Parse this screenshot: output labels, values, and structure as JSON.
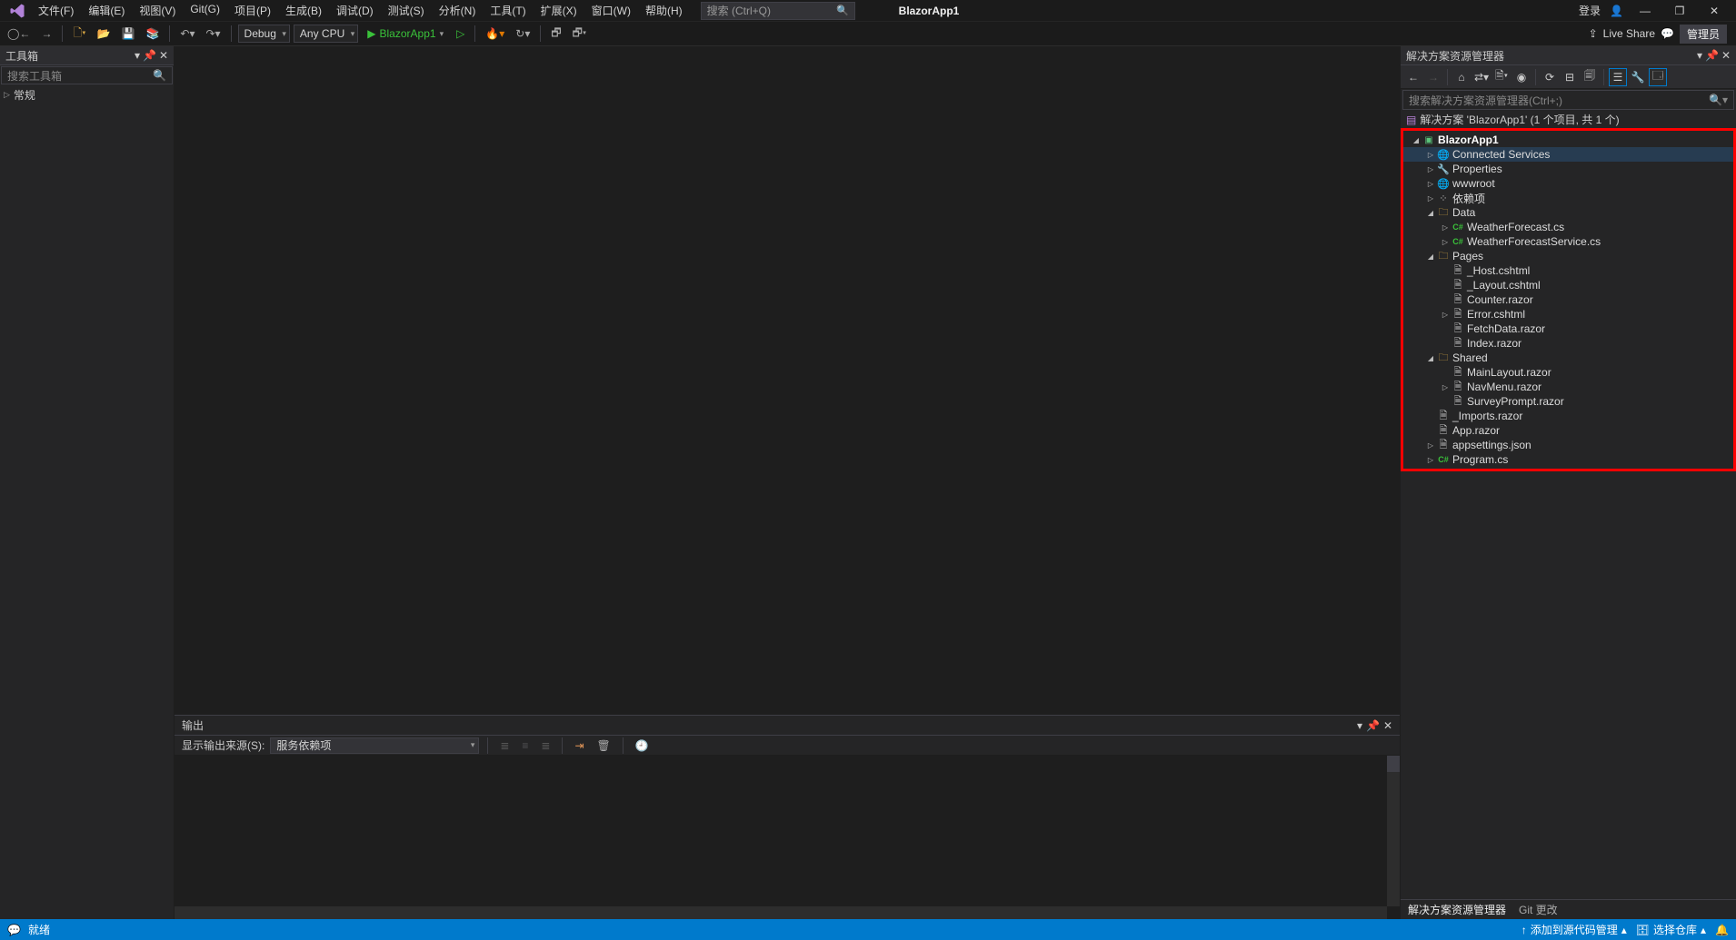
{
  "menubar": {
    "items": [
      "文件(F)",
      "编辑(E)",
      "视图(V)",
      "Git(G)",
      "项目(P)",
      "生成(B)",
      "调试(D)",
      "测试(S)",
      "分析(N)",
      "工具(T)",
      "扩展(X)",
      "窗口(W)",
      "帮助(H)"
    ],
    "search_placeholder": "搜索 (Ctrl+Q)",
    "app_title": "BlazorApp1",
    "login": "登录",
    "window_min": "—",
    "window_restore": "❐",
    "window_close": "✕"
  },
  "toolbar": {
    "config": "Debug",
    "platform": "Any CPU",
    "run_target": "BlazorApp1",
    "live_share": "Live Share",
    "admin": "管理员"
  },
  "toolbox": {
    "title": "工具箱",
    "search_placeholder": "搜索工具箱",
    "group": "常规"
  },
  "output": {
    "title": "输出",
    "source_label": "显示输出来源(S):",
    "source_value": "服务依赖项"
  },
  "solution_explorer": {
    "title": "解决方案资源管理器",
    "search_placeholder": "搜索解决方案资源管理器(Ctrl+;)",
    "solution_label": "解决方案 'BlazorApp1' (1 个项目, 共 1 个)",
    "tree": [
      {
        "depth": 0,
        "arrow": "open",
        "icon": "project",
        "label": "BlazorApp1",
        "bold": true
      },
      {
        "depth": 1,
        "arrow": "closed",
        "icon": "globe",
        "label": "Connected Services",
        "selected": true
      },
      {
        "depth": 1,
        "arrow": "closed",
        "icon": "wrench",
        "label": "Properties"
      },
      {
        "depth": 1,
        "arrow": "closed",
        "icon": "globe",
        "label": "wwwroot"
      },
      {
        "depth": 1,
        "arrow": "closed",
        "icon": "dep",
        "label": "依赖项"
      },
      {
        "depth": 1,
        "arrow": "open",
        "icon": "folder",
        "label": "Data"
      },
      {
        "depth": 2,
        "arrow": "closed",
        "icon": "csharp",
        "label": "WeatherForecast.cs"
      },
      {
        "depth": 2,
        "arrow": "closed",
        "icon": "csharp",
        "label": "WeatherForecastService.cs"
      },
      {
        "depth": 1,
        "arrow": "open",
        "icon": "folder",
        "label": "Pages"
      },
      {
        "depth": 2,
        "arrow": "none",
        "icon": "file",
        "label": "_Host.cshtml"
      },
      {
        "depth": 2,
        "arrow": "none",
        "icon": "file",
        "label": "_Layout.cshtml"
      },
      {
        "depth": 2,
        "arrow": "none",
        "icon": "file",
        "label": "Counter.razor"
      },
      {
        "depth": 2,
        "arrow": "closed",
        "icon": "file",
        "label": "Error.cshtml"
      },
      {
        "depth": 2,
        "arrow": "none",
        "icon": "file",
        "label": "FetchData.razor"
      },
      {
        "depth": 2,
        "arrow": "none",
        "icon": "file",
        "label": "Index.razor"
      },
      {
        "depth": 1,
        "arrow": "open",
        "icon": "folder",
        "label": "Shared"
      },
      {
        "depth": 2,
        "arrow": "none",
        "icon": "file",
        "label": "MainLayout.razor"
      },
      {
        "depth": 2,
        "arrow": "closed",
        "icon": "file",
        "label": "NavMenu.razor"
      },
      {
        "depth": 2,
        "arrow": "none",
        "icon": "file",
        "label": "SurveyPrompt.razor"
      },
      {
        "depth": 1,
        "arrow": "none",
        "icon": "file",
        "label": "_Imports.razor"
      },
      {
        "depth": 1,
        "arrow": "none",
        "icon": "file",
        "label": "App.razor"
      },
      {
        "depth": 1,
        "arrow": "closed",
        "icon": "file",
        "label": "appsettings.json"
      },
      {
        "depth": 1,
        "arrow": "closed",
        "icon": "csharp",
        "label": "Program.cs"
      }
    ],
    "bottom_tab_active": "解决方案资源管理器",
    "bottom_tab_other": "Git 更改"
  },
  "statusbar": {
    "ready": "就绪",
    "add_source_control": "添加到源代码管理",
    "select_repo": "选择仓库"
  }
}
